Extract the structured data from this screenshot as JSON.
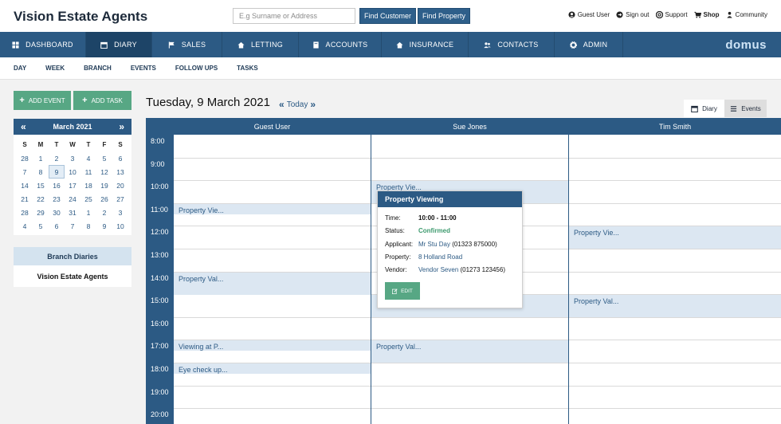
{
  "brand": "Vision Estate Agents",
  "search": {
    "placeholder": "E.g Surname or Address"
  },
  "buttons": {
    "find_customer": "Find Customer",
    "find_property": "Find Property"
  },
  "toplinks": [
    {
      "label": "Guest User",
      "icon": "user-icon"
    },
    {
      "label": "Sign out",
      "icon": "sign-out-icon"
    },
    {
      "label": "Support",
      "icon": "support-icon"
    },
    {
      "label": "Shop",
      "icon": "cart-icon"
    },
    {
      "label": "Community",
      "icon": "people-icon"
    }
  ],
  "nav": [
    {
      "label": "DASHBOARD",
      "icon": "dashboard-icon",
      "active": false
    },
    {
      "label": "DIARY",
      "icon": "calendar-icon",
      "active": true
    },
    {
      "label": "SALES",
      "icon": "flag-icon",
      "active": false
    },
    {
      "label": "LETTING",
      "icon": "home-icon",
      "active": false
    },
    {
      "label": "ACCOUNTS",
      "icon": "book-icon",
      "active": false
    },
    {
      "label": "INSURANCE",
      "icon": "house-shield-icon",
      "active": false
    },
    {
      "label": "CONTACTS",
      "icon": "contacts-icon",
      "active": false
    },
    {
      "label": "ADMIN",
      "icon": "gear-icon",
      "active": false
    }
  ],
  "logo": "domus",
  "subnav": [
    "DAY",
    "WEEK",
    "BRANCH",
    "EVENTS",
    "FOLLOW UPS",
    "TASKS"
  ],
  "actions": {
    "add_event": "ADD EVENT",
    "add_task": "ADD TASK"
  },
  "calendar": {
    "month": "March 2021",
    "dow": [
      "S",
      "M",
      "T",
      "W",
      "T",
      "F",
      "S"
    ],
    "weeks": [
      [
        "28",
        "1",
        "2",
        "3",
        "4",
        "5",
        "6"
      ],
      [
        "7",
        "8",
        "9",
        "10",
        "11",
        "12",
        "13"
      ],
      [
        "14",
        "15",
        "16",
        "17",
        "18",
        "19",
        "20"
      ],
      [
        "21",
        "22",
        "23",
        "24",
        "25",
        "26",
        "27"
      ],
      [
        "28",
        "29",
        "30",
        "31",
        "1",
        "2",
        "3"
      ],
      [
        "4",
        "5",
        "6",
        "7",
        "8",
        "9",
        "10"
      ]
    ],
    "selected": "9"
  },
  "branch": {
    "title": "Branch Diaries",
    "value": "Vision Estate Agents"
  },
  "date_heading": "Tuesday, 9 March 2021",
  "today_label": "Today",
  "view_tabs": [
    {
      "label": "Diary",
      "icon": "calendar-icon",
      "active": true
    },
    {
      "label": "Events",
      "icon": "list-icon",
      "active": false
    }
  ],
  "diary": {
    "columns": [
      "Guest User",
      "Sue Jones",
      "Tim Smith"
    ],
    "times": [
      "8:00",
      "9:00",
      "10:00",
      "11:00",
      "12:00",
      "13:00",
      "14:00",
      "15:00",
      "16:00",
      "17:00",
      "18:00",
      "19:00",
      "20:00"
    ],
    "events": [
      {
        "col": 0,
        "start": 11,
        "dur": 0.5,
        "label": "Property Vie..."
      },
      {
        "col": 0,
        "start": 14,
        "dur": 1,
        "label": "Property Val..."
      },
      {
        "col": 0,
        "start": 17,
        "dur": 0.5,
        "label": "Viewing at P..."
      },
      {
        "col": 0,
        "start": 18,
        "dur": 0.5,
        "label": "Eye check up..."
      },
      {
        "col": 1,
        "start": 10,
        "dur": 1,
        "label": "Property Vie..."
      },
      {
        "col": 1,
        "start": 15,
        "dur": 1,
        "label": ""
      },
      {
        "col": 1,
        "start": 17,
        "dur": 1,
        "label": "Property Val..."
      },
      {
        "col": 2,
        "start": 12,
        "dur": 1,
        "label": "Property Vie..."
      },
      {
        "col": 2,
        "start": 15,
        "dur": 1,
        "label": "Property Val..."
      }
    ]
  },
  "popup": {
    "title": "Property Viewing",
    "time_label": "Time:",
    "time": "10:00 - 11:00",
    "status_label": "Status:",
    "status": "Confirmed",
    "applicant_label": "Applicant:",
    "applicant": "Mr Stu Day",
    "applicant_phone": " (01323 875000)",
    "property_label": "Property:",
    "property": "8 Holland Road",
    "vendor_label": "Vendor:",
    "vendor": "Vendor Seven",
    "vendor_phone": " (01273 123456)",
    "edit": "EDIT"
  },
  "colors": {
    "navy": "#2c5a84",
    "green": "#57a784",
    "event_bg": "#dce7f2"
  }
}
